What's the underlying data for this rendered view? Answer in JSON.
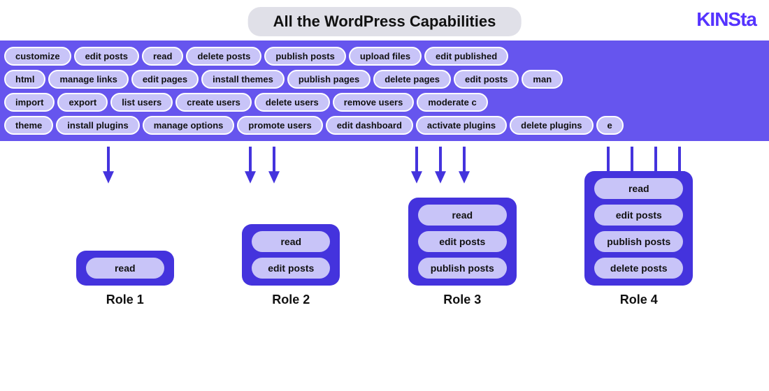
{
  "logo": {
    "text": "KINSta"
  },
  "title": "All the WordPress Capabilities",
  "capabilities": {
    "row1": [
      "customize",
      "edit posts",
      "read",
      "delete posts",
      "publish posts",
      "upload files",
      "edit published"
    ],
    "row2": [
      "html",
      "manage links",
      "edit pages",
      "install themes",
      "publish pages",
      "delete pages",
      "edit posts",
      "man"
    ],
    "row3": [
      "import",
      "export",
      "list users",
      "create users",
      "delete users",
      "remove users",
      "moderate c"
    ],
    "row4": [
      "theme",
      "install plugins",
      "manage options",
      "promote users",
      "edit dashboard",
      "activate plugins",
      "delete plugins",
      "e"
    ]
  },
  "roles": [
    {
      "id": "role1",
      "label": "Role 1",
      "capabilities": [
        "read"
      ],
      "arrows": 1
    },
    {
      "id": "role2",
      "label": "Role 2",
      "capabilities": [
        "read",
        "edit posts"
      ],
      "arrows": 2
    },
    {
      "id": "role3",
      "label": "Role 3",
      "capabilities": [
        "read",
        "edit posts",
        "publish posts"
      ],
      "arrows": 3
    },
    {
      "id": "role4",
      "label": "Role 4",
      "capabilities": [
        "read",
        "edit posts",
        "publish posts",
        "delete posts"
      ],
      "arrows": 4
    }
  ]
}
